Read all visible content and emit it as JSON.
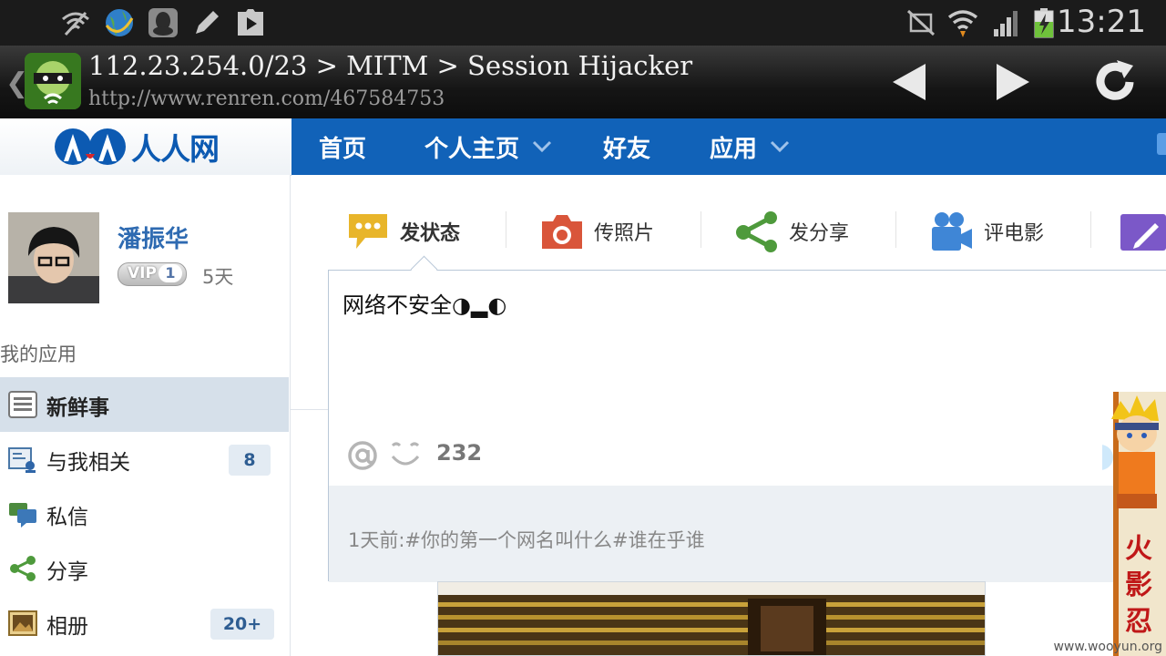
{
  "status_bar": {
    "time": "13:21"
  },
  "titlebar": {
    "title": "112.23.254.0/23 > MITM > Session Hijacker",
    "url": "http://www.renren.com/467584753"
  },
  "site": {
    "logo_text": "人人网",
    "nav": [
      {
        "label": "首页"
      },
      {
        "label": "个人主页"
      },
      {
        "label": "好友"
      },
      {
        "label": "应用"
      }
    ]
  },
  "profile": {
    "name": "潘振华",
    "vip_label": "VIP",
    "vip_level": "1",
    "vip_days": "5天"
  },
  "sidebar": {
    "section_label": "我的应用",
    "items": [
      {
        "label": "新鲜事",
        "count": ""
      },
      {
        "label": "与我相关",
        "count": "8"
      },
      {
        "label": "私信",
        "count": ""
      },
      {
        "label": "分享",
        "count": ""
      },
      {
        "label": "相册",
        "count": "20+"
      }
    ]
  },
  "publisher": {
    "tabs": [
      {
        "label": "发状态"
      },
      {
        "label": "传照片"
      },
      {
        "label": "发分享"
      },
      {
        "label": "评电影"
      }
    ],
    "text": "网络不安全◑▂◐",
    "remaining_chars": "232",
    "latest_status": "1天前:#你的第一个网名叫什么#谁在乎谁"
  },
  "watermark": "www.wooyun.org",
  "colors": {
    "nav_blue": "#1162b8",
    "link_blue": "#2e6ab1",
    "status_bar": "#1b1b1b"
  }
}
